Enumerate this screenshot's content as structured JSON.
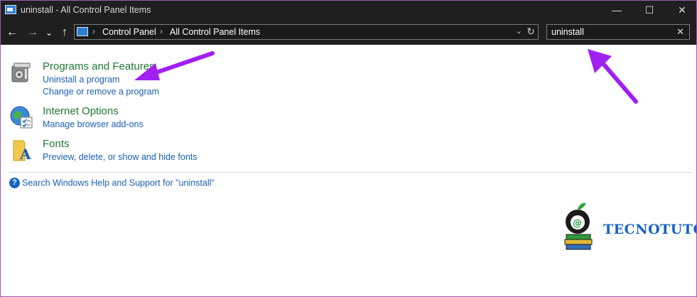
{
  "window": {
    "title": "uninstall - All Control Panel Items",
    "controls": {
      "minimize": "—",
      "maximize": "☐",
      "close": "✕"
    }
  },
  "nav": {
    "back": "←",
    "forward": "→",
    "recent": "⌄",
    "up": "↑"
  },
  "address": {
    "segments": [
      "Control Panel",
      "All Control Panel Items"
    ],
    "separator": "›",
    "dropdown": "⌄",
    "refresh": "↻"
  },
  "search": {
    "value": "uninstall",
    "clear": "✕"
  },
  "results": [
    {
      "heading": "Programs and Features",
      "links": [
        "Uninstall a program",
        "Change or remove a program"
      ],
      "icon": "programs-icon"
    },
    {
      "heading": "Internet Options",
      "links": [
        "Manage browser add-ons"
      ],
      "icon": "internet-options-icon"
    },
    {
      "heading": "Fonts",
      "links": [
        "Preview, delete, or show and hide fonts"
      ],
      "icon": "fonts-icon"
    }
  ],
  "help": {
    "text": "Search Windows Help and Support for \"uninstall\"",
    "icon": "help-icon"
  },
  "watermark": {
    "brand": "TECNOTUTO"
  },
  "colors": {
    "titlebar": "#1f1f1f",
    "heading_green": "#1e7a2f",
    "link_blue": "#1a5fb4",
    "annotation_purple": "#a020f0"
  }
}
